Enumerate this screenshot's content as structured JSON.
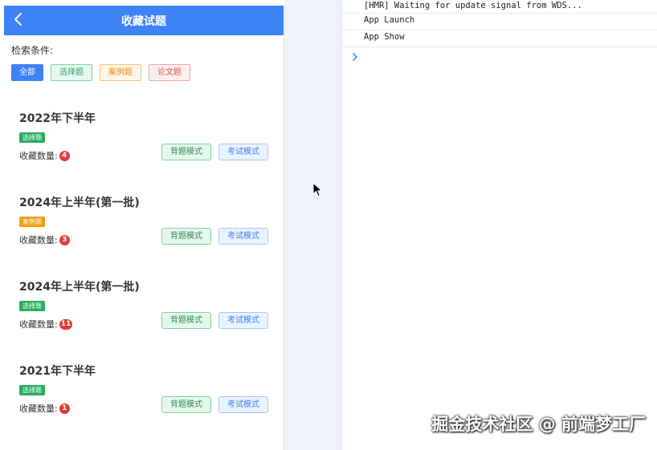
{
  "navbar": {
    "title": "收藏试题",
    "back_icon": "chevron-left-icon"
  },
  "filter": {
    "label": "检索条件:",
    "chips": [
      {
        "label": "全部",
        "selected": true
      },
      {
        "label": "选择题",
        "selected": false
      },
      {
        "label": "案例题",
        "selected": false
      },
      {
        "label": "论文题",
        "selected": false
      }
    ]
  },
  "cards": [
    {
      "title": "2022年下半年",
      "type": "选择题",
      "type_color": "#27ae60",
      "count_label": "收藏数量:",
      "count": "4",
      "recite_label": "背题模式",
      "exam_label": "考试模式"
    },
    {
      "title": "2024年上半年(第一批)",
      "type": "案例题",
      "type_color": "#f39c12",
      "count_label": "收藏数量:",
      "count": "3",
      "recite_label": "背题模式",
      "exam_label": "考试模式"
    },
    {
      "title": "2024年上半年(第一批)",
      "type": "选择题",
      "type_color": "#27ae60",
      "count_label": "收藏数量:",
      "count": "11",
      "recite_label": "背题模式",
      "exam_label": "考试模式"
    },
    {
      "title": "2021年下半年",
      "type": "选择题",
      "type_color": "#27ae60",
      "count_label": "收藏数量:",
      "count": "1",
      "recite_label": "背题模式",
      "exam_label": "考试模式"
    }
  ],
  "console": {
    "lines": [
      "[HMR] Waiting for update signal from WDS...",
      "App Launch",
      "App Show"
    ],
    "prompt_icon": "chevron-right-icon"
  },
  "watermark": "掘金技术社区 @ 前端梦工厂",
  "colors": {
    "primary": "#3e82f7",
    "success": "#27ae60",
    "warning": "#f39c12",
    "danger": "#e53935"
  }
}
